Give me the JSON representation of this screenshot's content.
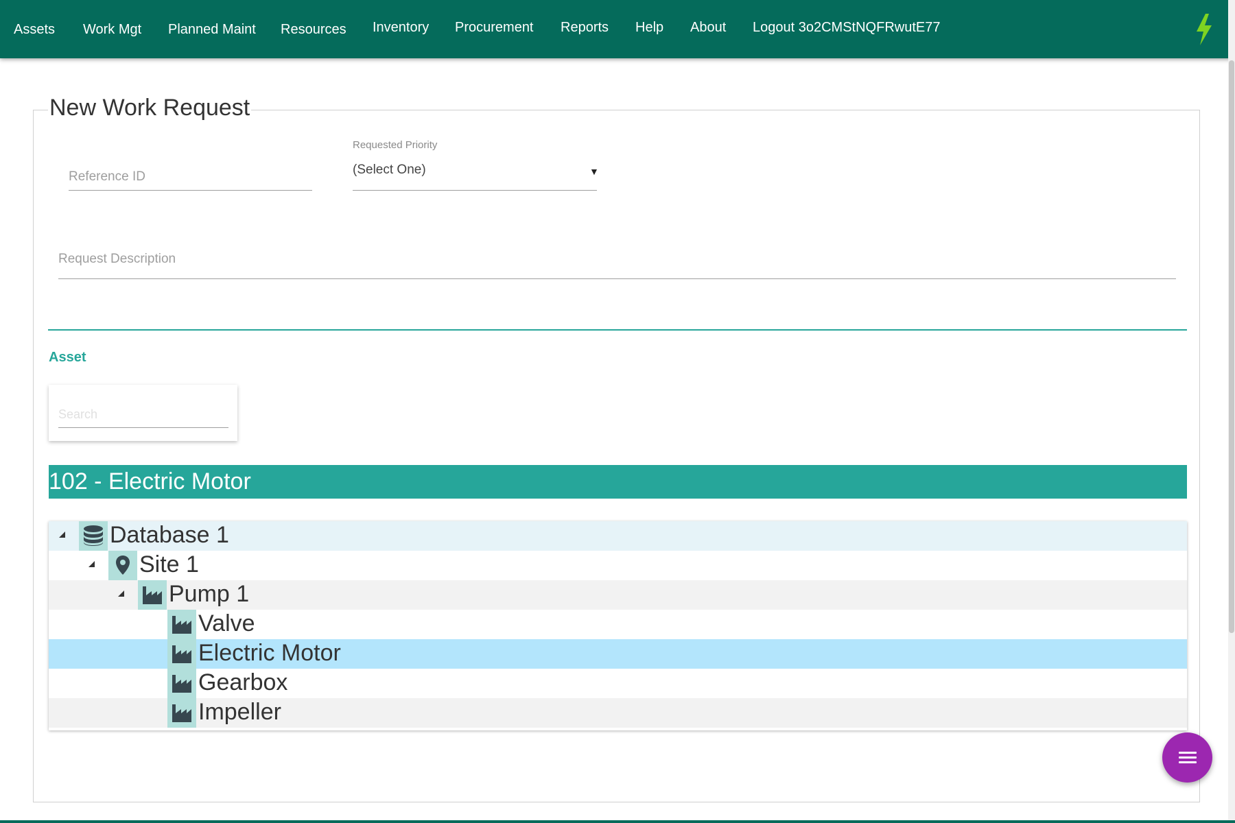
{
  "nav": {
    "items": [
      "Assets",
      "Work Mgt",
      "Planned Maint",
      "Resources",
      "Inventory",
      "Procurement",
      "Reports",
      "Help",
      "About",
      "Logout 3o2CMStNQFRwutE77"
    ],
    "logo_icon": "lightning-bolt-icon"
  },
  "form": {
    "title": "New Work Request",
    "reference_id": {
      "placeholder": "Reference ID",
      "value": ""
    },
    "priority": {
      "label": "Requested Priority",
      "value": "(Select One)"
    },
    "description": {
      "placeholder": "Request Description",
      "value": ""
    },
    "asset_label": "Asset",
    "search": {
      "placeholder": "Search"
    }
  },
  "selected_asset": "102 - Electric Motor",
  "tree": [
    {
      "label": "Database 1",
      "icon": "database-icon",
      "level": 0,
      "expanded": true
    },
    {
      "label": "Site 1",
      "icon": "map-marker-icon",
      "level": 1,
      "expanded": true
    },
    {
      "label": "Pump 1",
      "icon": "factory-icon",
      "level": 2,
      "expanded": true
    },
    {
      "label": "Valve",
      "icon": "factory-icon",
      "level": 3
    },
    {
      "label": "Electric Motor",
      "icon": "factory-icon",
      "level": 3,
      "selected": true
    },
    {
      "label": "Gearbox",
      "icon": "factory-icon",
      "level": 3
    },
    {
      "label": "Impeller",
      "icon": "factory-icon",
      "level": 3
    }
  ],
  "colors": {
    "nav_bg": "#056b5b",
    "accent": "#26a69a",
    "tree_icon_bg": "#b2dfdb",
    "row_database": "#e6f3f8",
    "row_alt": "#f2f2f2",
    "row_selected": "#b3e5fc",
    "fab": "#9c27b0",
    "bolt": "#7ed321"
  },
  "fab_icon": "menu-icon"
}
